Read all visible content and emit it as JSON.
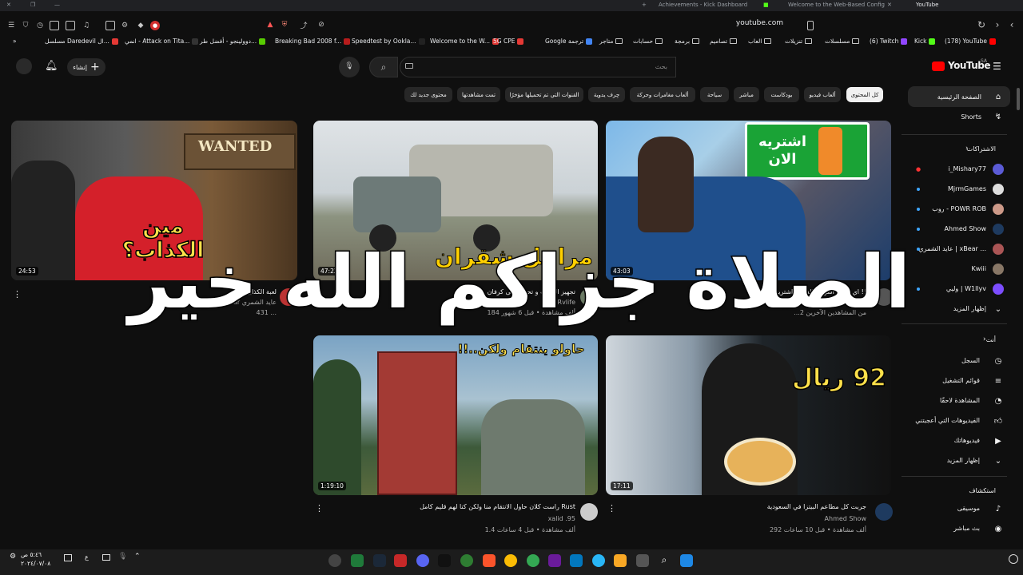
{
  "tabs": [
    {
      "label": "Achievements - Kick Dashboard"
    },
    {
      "label": "Welcome to the Web-Based Config"
    },
    {
      "label": "YouTube"
    }
  ],
  "address": {
    "url": "youtube.com"
  },
  "bookmarks": [
    {
      "label": "Kick"
    },
    {
      "label": "(178) YouTube"
    },
    {
      "label": "(6) Twitch"
    },
    {
      "label": "مسلسلات"
    },
    {
      "label": "تنزيلات"
    },
    {
      "label": "العاب"
    },
    {
      "label": "تصاميم"
    },
    {
      "label": "برمجة"
    },
    {
      "label": "حسابات"
    },
    {
      "label": "متاجر"
    },
    {
      "label": "Google ترجمة"
    },
    {
      "label": "5G CPE"
    },
    {
      "label": "Welcome to the W..."
    },
    {
      "label": "Speedtest by Ookla..."
    },
    {
      "label": "Breaking Bad 2008 f..."
    },
    {
      "label": "دوولينجو - أفضل طر..."
    },
    {
      "label": "انمي - Attack on Tita..."
    },
    {
      "label": "مسلسل Daredevil ال..."
    }
  ],
  "header": {
    "logo": "YouTube",
    "logo_region": "SA",
    "search_placeholder": "بحث",
    "create_label": "إنشاء"
  },
  "chips": [
    "كل المحتوى",
    "ألعاب فيديو",
    "بودكاست",
    "مباشر",
    "سياحة",
    "ألعاب مغامرات وحركة",
    "حِرف يدوية",
    "القنوات التي تم تحميلها مؤخرًا",
    "تمت مشاهدتها",
    "محتوى جديد لك"
  ],
  "sidebar": {
    "home": "الصفحة الرئيسية",
    "shorts": "Shorts",
    "subs_title": "الاشتراكات",
    "subs": [
      "i_Mishary77",
      "MjrmGames",
      "روب - POWR ROB",
      "Ahmed Show",
      "عايد الشمري | xBear ...",
      "Kwiii",
      "وليي | W1llyv"
    ],
    "show_more": "إظهار المزيد",
    "you_title": "أنت",
    "you": [
      "السجل",
      "قوائم التشغيل",
      "المشاهدة لاحقًا",
      "الفيديوهات التي أعجبتني",
      "فيديوهاتك",
      "إظهار المزيد"
    ],
    "explore_title": "استكشاف",
    "explore": [
      "موسيقى",
      "بث مباشر"
    ]
  },
  "videos": [
    {
      "title": "اي اعلان اشوفه بالشارع اشتريه !!",
      "channel": "ابو ...",
      "meta": "...2 من المشاهدين الآخرين",
      "duration": "43:03",
      "overlay": "اشتريه الان"
    },
    {
      "title": "تجهيز الوانيت و تحويله الى كرفان",
      "channel": "Rvlife",
      "meta": "184 ألف مشاهدة • قبل 6 شهور",
      "duration": "47:22",
      "overlay": "مراحل شقران"
    },
    {
      "title": "لعبة الكذابين",
      "channel": "xbear عايد الشمري",
      "meta": "431 ...",
      "duration": "24:53",
      "overlay": "مين الكذاب؟"
    },
    {
      "title": "جربت كل مطاعم البيتزا في السعودية",
      "channel": "Ahmed Show",
      "meta": "292 ألف مشاهدة • قبل 10 ساعات",
      "duration": "17:11",
      "overlay": "92 ريال"
    },
    {
      "title": "راست كلان حاول الانتقام منا ولكن كنا لهم قليم كامل Rust",
      "channel": "xalid .95",
      "meta": "1.4 ألف مشاهدة • قبل 4 ساعات",
      "duration": "1:19:10",
      "overlay": "حاولو ينتقام ولكن..!!"
    }
  ],
  "overlay_text": "الصلاة جزاكم الله خير",
  "taskbar": {
    "time": "٥:٤٦ ص",
    "date": "٢٠٢٤/٠٧/٠٨"
  }
}
